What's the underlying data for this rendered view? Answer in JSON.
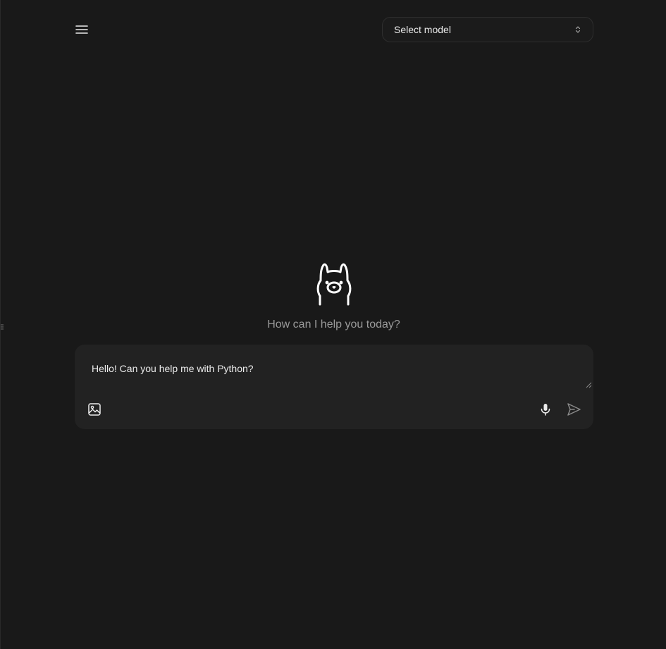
{
  "header": {
    "menu_icon": "hamburger-menu-icon",
    "model_select": {
      "label": "Select model",
      "icon": "chevron-up-down-icon"
    }
  },
  "main": {
    "logo_icon": "llama-logo-icon",
    "greeting": "How can I help you today?"
  },
  "composer": {
    "input_value": "Hello! Can you help me with Python?",
    "image_icon": "image-upload-icon",
    "mic_icon": "microphone-icon",
    "send_icon": "send-icon"
  },
  "colors": {
    "background": "#191919",
    "composer_bg": "#222222",
    "text": "#ececec",
    "muted_text": "#9a9a9a"
  }
}
